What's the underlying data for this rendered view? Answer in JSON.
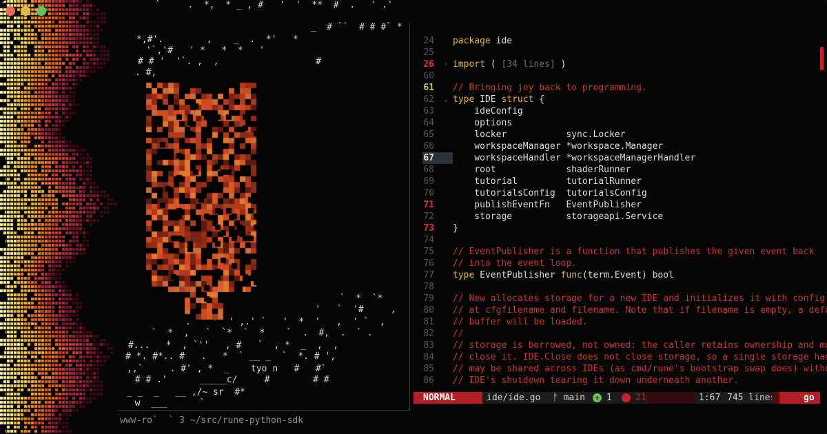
{
  "window": {
    "traffic_lights": [
      "close",
      "minimize",
      "maximize"
    ]
  },
  "ascii_art": [
    "   `     .  *,  * _ , #   '  '  **  #  .   ' .'",
    "                   _  # ``  # # #` * ,' `  ",
    "*,#'.        ,    _  .  *'   *",
    " '`,'#   ' *   *  *   '",
    "# # '  '`. ,  ,                  #",
    ". #,",
    "                                 .",
    "                                 #",
    "                           *    .  .",
    "                  `  *  `*      *      #",
    "                '   `  '#     ,        # '",
    "     .    '  ' ,.' `   '  *  '   ,  ' `  ,",
    " `  *  ,   `  `*  `  *    `  .  #,  .  ` .  ",
    "#...   *  , `''   , #   `  , *  _  ,  ,",
    "# *. #*.. #   .   *  ` __ _  `  *. # ',",
    ",,`     . #' , *  _    tyo n   #   #`",
    " # # .'      _____c/     #        # #",
    " _ _  _   __ ,/~ sr  #*",
    "  w  ___      `",
    "                   "
  ],
  "shell": {
    "line": "www-ro`  ` 3 ~/src/rune-python-sdk"
  },
  "editor": {
    "lines": [
      {
        "n": "24",
        "cls": "",
        "fold": "",
        "segs": [
          {
            "t": "package",
            "c": "kw"
          },
          {
            "t": " ide",
            "c": ""
          }
        ]
      },
      {
        "n": "25",
        "cls": "",
        "fold": "",
        "segs": []
      },
      {
        "n": "26",
        "cls": "err",
        "fold": "›",
        "segs": [
          {
            "t": "import",
            "c": "kw"
          },
          {
            "t": " ( ",
            "c": ""
          },
          {
            "t": "[34 lines]",
            "c": "dim"
          },
          {
            "t": " )",
            "c": ""
          }
        ]
      },
      {
        "n": "60",
        "cls": "",
        "fold": "",
        "segs": []
      },
      {
        "n": "61",
        "cls": "ok",
        "fold": "",
        "segs": [
          {
            "t": "// Bringing joy back to programming.",
            "c": "comment"
          }
        ]
      },
      {
        "n": "62",
        "cls": "",
        "fold": "⌄",
        "segs": [
          {
            "t": "type",
            "c": "kw"
          },
          {
            "t": " IDE ",
            "c": ""
          },
          {
            "t": "struct",
            "c": "kw"
          },
          {
            "t": " {",
            "c": ""
          }
        ]
      },
      {
        "n": "63",
        "cls": "",
        "fold": "",
        "segs": [
          {
            "t": "    ideConfig",
            "c": ""
          }
        ]
      },
      {
        "n": "64",
        "cls": "",
        "fold": "",
        "segs": [
          {
            "t": "    options",
            "c": ""
          }
        ]
      },
      {
        "n": "65",
        "cls": "",
        "fold": "",
        "segs": [
          {
            "t": "    locker           sync.Locker",
            "c": ""
          }
        ]
      },
      {
        "n": "66",
        "cls": "",
        "fold": "",
        "segs": [
          {
            "t": "    workspaceManager *workspace.Manager",
            "c": ""
          }
        ]
      },
      {
        "n": "67",
        "cls": "hi",
        "fold": "",
        "segs": [
          {
            "t": "    workspaceHandler *workspaceManagerHandler",
            "c": ""
          }
        ]
      },
      {
        "n": "68",
        "cls": "",
        "fold": "",
        "segs": [
          {
            "t": "    root             shaderRunner",
            "c": ""
          }
        ]
      },
      {
        "n": "69",
        "cls": "",
        "fold": "",
        "segs": [
          {
            "t": "    tutorial         tutorialRunner",
            "c": ""
          }
        ]
      },
      {
        "n": "70",
        "cls": "",
        "fold": "",
        "segs": [
          {
            "t": "    tutorialsConfig  tutorialsConfig",
            "c": ""
          }
        ]
      },
      {
        "n": "71",
        "cls": "err",
        "fold": "",
        "segs": [
          {
            "t": "    publishEventFn   EventPublisher",
            "c": ""
          }
        ]
      },
      {
        "n": "72",
        "cls": "",
        "fold": "",
        "segs": [
          {
            "t": "    storage          storageapi.Service",
            "c": ""
          }
        ]
      },
      {
        "n": "73",
        "cls": "err",
        "fold": "",
        "segs": [
          {
            "t": "}",
            "c": ""
          }
        ]
      },
      {
        "n": "74",
        "cls": "",
        "fold": "",
        "segs": []
      },
      {
        "n": "75",
        "cls": "",
        "fold": "",
        "segs": [
          {
            "t": "// EventPublisher is a function that publishes the given event back",
            "c": "comment"
          }
        ]
      },
      {
        "n": "76",
        "cls": "",
        "fold": "",
        "segs": [
          {
            "t": "// into the event loop.",
            "c": "comment"
          }
        ]
      },
      {
        "n": "77",
        "cls": "",
        "fold": "",
        "segs": [
          {
            "t": "type",
            "c": "kw"
          },
          {
            "t": " EventPublisher ",
            "c": ""
          },
          {
            "t": "func",
            "c": "fn"
          },
          {
            "t": "(term.Event) bool",
            "c": ""
          }
        ]
      },
      {
        "n": "78",
        "cls": "",
        "fold": "",
        "segs": []
      },
      {
        "n": "79",
        "cls": "",
        "fold": "",
        "segs": [
          {
            "t": "// New allocates storage for a new IDE and initializes it with config",
            "c": "comment"
          }
        ]
      },
      {
        "n": "80",
        "cls": "",
        "fold": "",
        "segs": [
          {
            "t": "// at cfgfilename and filename. Note that if filename is empty, a default in",
            "c": "comment"
          }
        ]
      },
      {
        "n": "81",
        "cls": "",
        "fold": "",
        "segs": [
          {
            "t": "// buffer will be loaded.",
            "c": "comment"
          }
        ]
      },
      {
        "n": "82",
        "cls": "",
        "fold": "",
        "segs": [
          {
            "t": "//",
            "c": "comment"
          }
        ]
      },
      {
        "n": "83",
        "cls": "",
        "fold": "",
        "segs": [
          {
            "t": "// storage is borrowed, not owned: the caller retains ownership and must",
            "c": "comment"
          }
        ]
      },
      {
        "n": "84",
        "cls": "",
        "fold": "",
        "segs": [
          {
            "t": "// close it. IDE.Close does not close storage, so a single storage handle",
            "c": "comment"
          }
        ]
      },
      {
        "n": "85",
        "cls": "",
        "fold": "",
        "segs": [
          {
            "t": "// may be shared across IDEs (as cmd/rune's bootstrap swap does) without one",
            "c": "comment"
          }
        ]
      },
      {
        "n": "86",
        "cls": "",
        "fold": "",
        "segs": [
          {
            "t": "// IDE's shutdown tearing it down underneath another.",
            "c": "comment"
          }
        ]
      }
    ],
    "cursor_line_index": 10
  },
  "statusline": {
    "mode": "NORMAL",
    "file": "ide/ide.go",
    "branch": "ᚠ main",
    "add_icon": "+",
    "added": "1",
    "errors": "21",
    "position": "1:67",
    "lines": "745 lines",
    "filetype": "go"
  },
  "colors": {
    "accent": "#b51d24",
    "comment": "#c8342c",
    "keyword": "#e2b23c",
    "fire_hot": "#f4d35e",
    "fire_mid": "#f08a1e",
    "fire_cool": "#9a1f3a"
  }
}
